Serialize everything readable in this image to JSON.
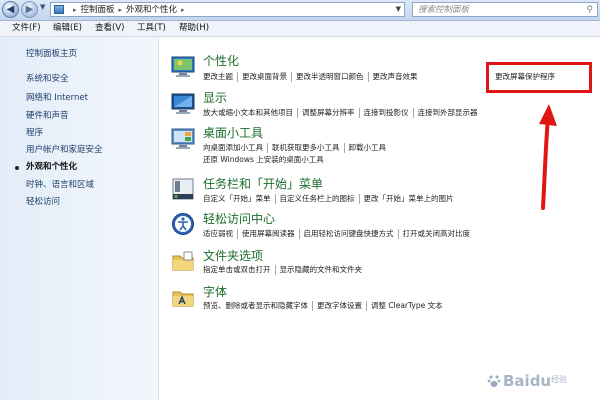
{
  "address_bar": {
    "crumbs": [
      "控制面板",
      "外观和个性化"
    ],
    "search_placeholder": "搜索控制面板"
  },
  "menu": {
    "items": [
      "文件(F)",
      "编辑(E)",
      "查看(V)",
      "工具(T)",
      "帮助(H)"
    ]
  },
  "sidebar": {
    "home": "控制面板主页",
    "items": [
      "系统和安全",
      "网络和 Internet",
      "硬件和声音",
      "程序",
      "用户帐户和家庭安全",
      "外观和个性化",
      "时钟、语言和区域",
      "轻松访问"
    ],
    "current_index": 5
  },
  "categories": [
    {
      "title": "个性化",
      "icon": "personalization-icon",
      "links": [
        [
          "更改主题",
          "更改桌面背景",
          "更改半透明窗口颜色",
          "更改声音效果",
          "更改屏幕保护程序"
        ]
      ]
    },
    {
      "title": "显示",
      "icon": "display-icon",
      "links": [
        [
          "放大或缩小文本和其他项目",
          "调整屏幕分辨率",
          "连接到投影仪",
          "连接到外部显示器"
        ]
      ]
    },
    {
      "title": "桌面小工具",
      "icon": "gadgets-icon",
      "links": [
        [
          "向桌面添加小工具",
          "联机获取更多小工具",
          "卸载小工具"
        ],
        [
          "还原 Windows 上安装的桌面小工具"
        ]
      ]
    },
    {
      "title": "任务栏和「开始」菜单",
      "icon": "taskbar-icon",
      "links": [
        [
          "自定义「开始」菜单",
          "自定义任务栏上的图标",
          "更改「开始」菜单上的图片"
        ]
      ]
    },
    {
      "title": "轻松访问中心",
      "icon": "ease-of-access-icon",
      "links": [
        [
          "适应弱视",
          "使用屏幕阅读器",
          "启用轻松访问键盘快捷方式",
          "打开或关闭高对比度"
        ]
      ]
    },
    {
      "title": "文件夹选项",
      "icon": "folder-options-icon",
      "links": [
        [
          "指定单击或双击打开",
          "显示隐藏的文件和文件夹"
        ]
      ]
    },
    {
      "title": "字体",
      "icon": "fonts-icon",
      "links": [
        [
          "预览、删除或者显示和隐藏字体",
          "更改字体设置",
          "调整 ClearType 文本"
        ]
      ]
    }
  ],
  "highlight": {
    "label": "更改屏幕保护程序",
    "color": "#e01515"
  },
  "watermark": {
    "brand": "Baidu",
    "text": "经验"
  },
  "colors": {
    "category_title": "#1c6c2c",
    "sidebar_link": "#1f3f6b",
    "accent": "#e01515"
  }
}
